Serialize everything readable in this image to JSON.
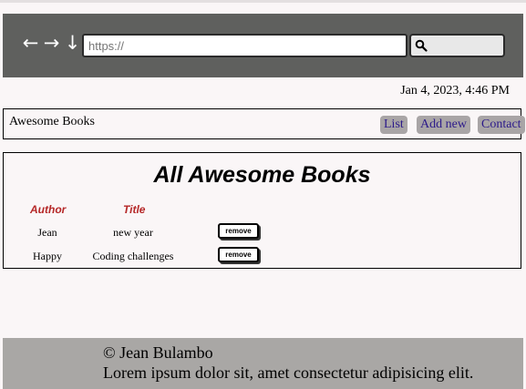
{
  "browser": {
    "url_placeholder": "https://",
    "nav_icons": [
      "back-arrow-icon",
      "forward-arrow-icon",
      "download-arrow-icon"
    ]
  },
  "datetime": "Jan 4, 2023, 4:46 PM",
  "navbar": {
    "brand": "Awesome Books",
    "links": [
      "List",
      "Add new",
      "Contact"
    ]
  },
  "books_section": {
    "title": "All Awesome Books",
    "headers": {
      "author": "Author",
      "title": "Title"
    },
    "rows": [
      {
        "author": "Jean",
        "title": "new year",
        "button": "remove"
      },
      {
        "author": "Happy",
        "title": "Coding challenges",
        "button": "remove"
      }
    ]
  },
  "footer": {
    "copyright": "© Jean Bulambo",
    "text": "Lorem ipsum dolor sit, amet consectetur adipisicing elit."
  },
  "colors": {
    "browser_bar": "#5f605e",
    "header_text": "#b52727",
    "nav_button_bg": "#a9a5a6",
    "nav_link_text": "#2c1a8a",
    "footer_bg": "#a9a7a5",
    "page_bg": "#faf6f7"
  }
}
